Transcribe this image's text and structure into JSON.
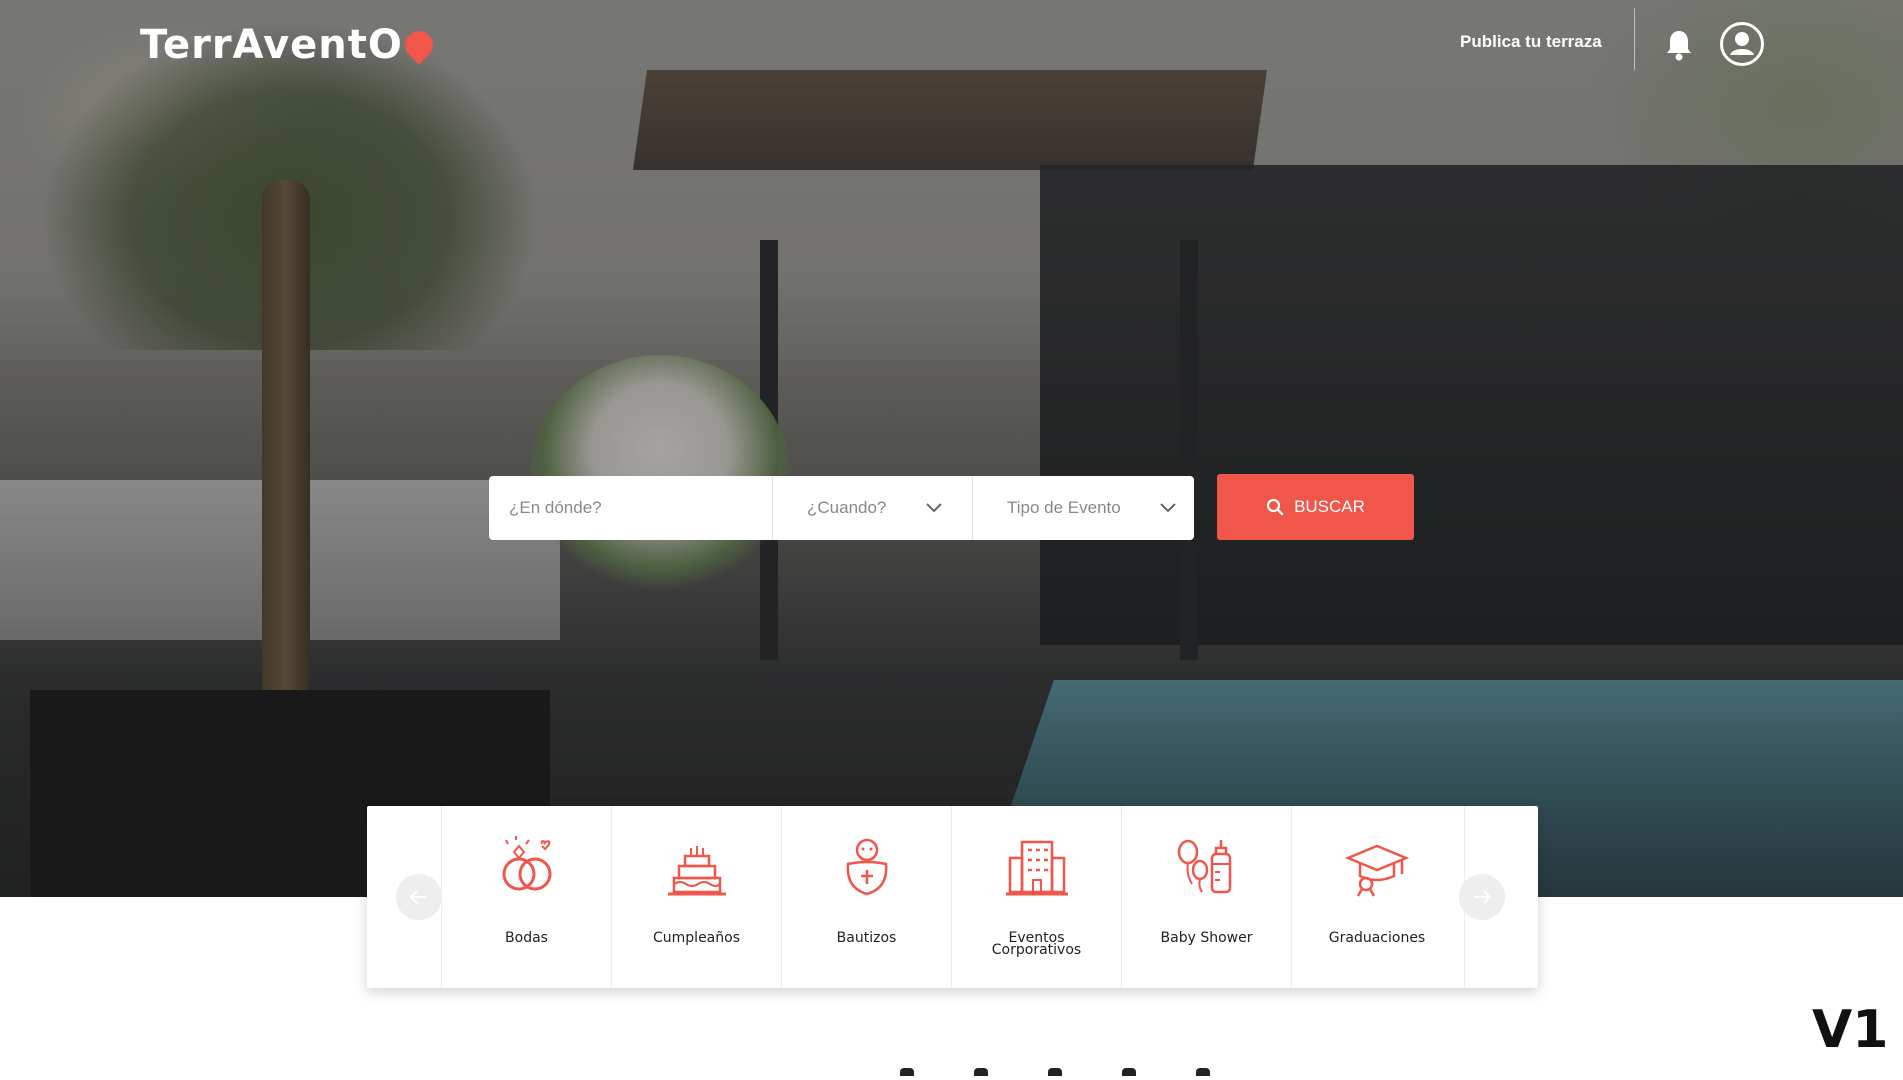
{
  "header": {
    "logo_text": "TerrAventO",
    "publish_link": "Publica tu terraza",
    "bell_icon": "bell-icon",
    "user_icon": "user-circle-icon"
  },
  "search": {
    "where_placeholder": "¿En dónde?",
    "when_label": "¿Cuando?",
    "event_type_label": "Tipo de Evento",
    "button_label": "BUSCAR"
  },
  "categories": [
    {
      "label": "Bodas",
      "icon": "wedding-rings-icon"
    },
    {
      "label": "Cumpleaños",
      "icon": "birthday-cake-icon"
    },
    {
      "label": "Bautizos",
      "icon": "baptism-baby-icon"
    },
    {
      "label": "Eventos Corporativos",
      "icon": "corporate-building-icon"
    },
    {
      "label": "Baby Shower",
      "icon": "baby-shower-icon"
    },
    {
      "label": "Graduaciones",
      "icon": "graduation-cap-icon"
    }
  ],
  "version_label": "V1",
  "colors": {
    "accent": "#f0564a",
    "white": "#ffffff"
  }
}
